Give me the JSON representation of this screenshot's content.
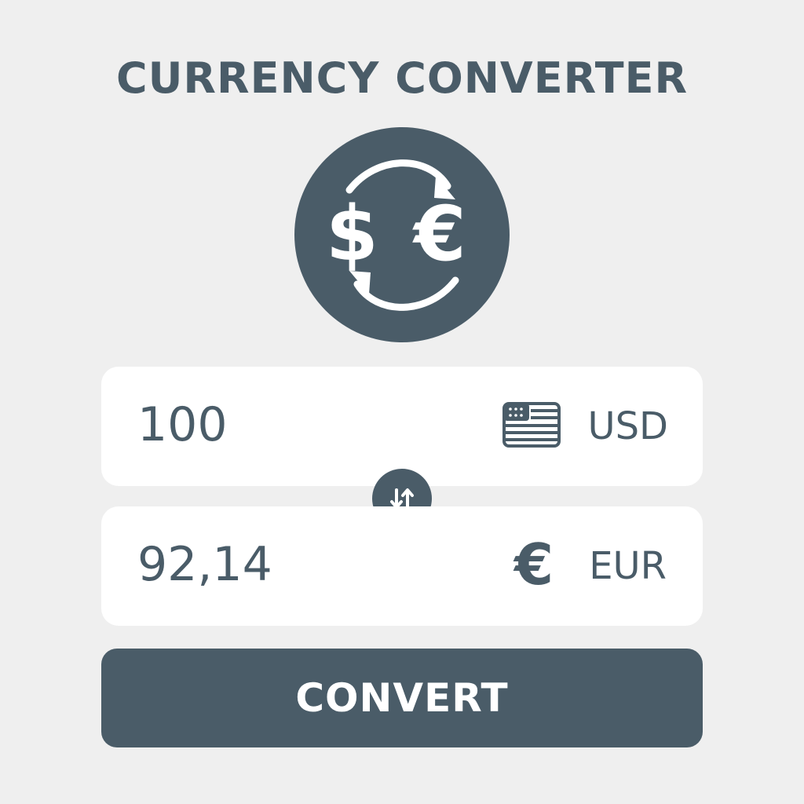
{
  "header": {
    "title": "CURRENCY CONVERTER"
  },
  "logo": {
    "icon": "currency-exchange-icon",
    "from_symbol": "$",
    "to_symbol": "€"
  },
  "from": {
    "amount": "100",
    "currency": "USD",
    "icon": "us-flag-icon"
  },
  "to": {
    "amount": "92,14",
    "currency": "EUR",
    "icon_symbol": "€",
    "icon": "euro-icon"
  },
  "swap": {
    "icon": "swap-arrows-icon"
  },
  "actions": {
    "convert_label": "CONVERT"
  },
  "colors": {
    "background": "#efefef",
    "primary": "#4a5c68",
    "card": "#ffffff"
  }
}
